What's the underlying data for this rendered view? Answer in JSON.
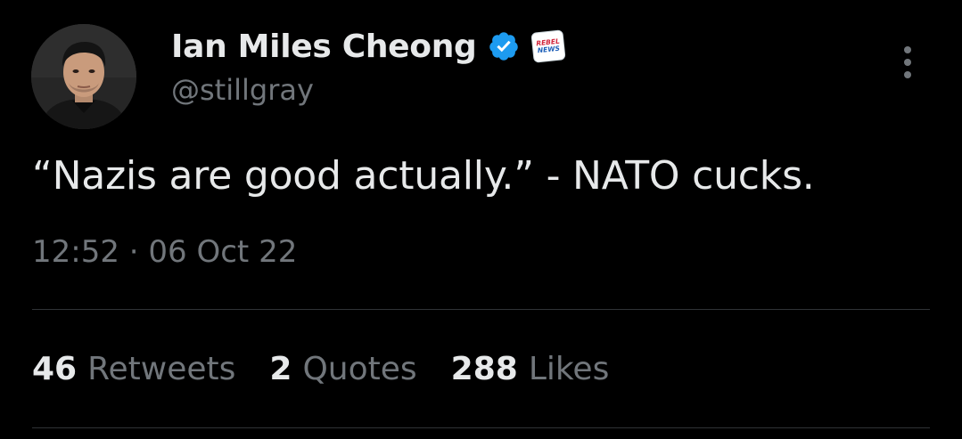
{
  "author": {
    "display_name": "Ian Miles Cheong",
    "handle": "@stillgray",
    "verified": true,
    "affiliate_badge": {
      "line1": "REBEL",
      "line2": "NEWS"
    }
  },
  "tweet": {
    "text": "“Nazis are good actually.” - NATO cucks.",
    "timestamp": "12:52 · 06 Oct 22"
  },
  "stats": [
    {
      "count": "46",
      "label": "Retweets"
    },
    {
      "count": "2",
      "label": "Quotes"
    },
    {
      "count": "288",
      "label": "Likes"
    }
  ],
  "colors": {
    "background": "#000000",
    "primary_text": "#e7e9ea",
    "secondary_text": "#71767b",
    "verified_blue": "#1d9bf0",
    "divider": "#2f3336"
  },
  "icons": {
    "verified": "verified-badge-icon",
    "more": "more-options-icon"
  }
}
